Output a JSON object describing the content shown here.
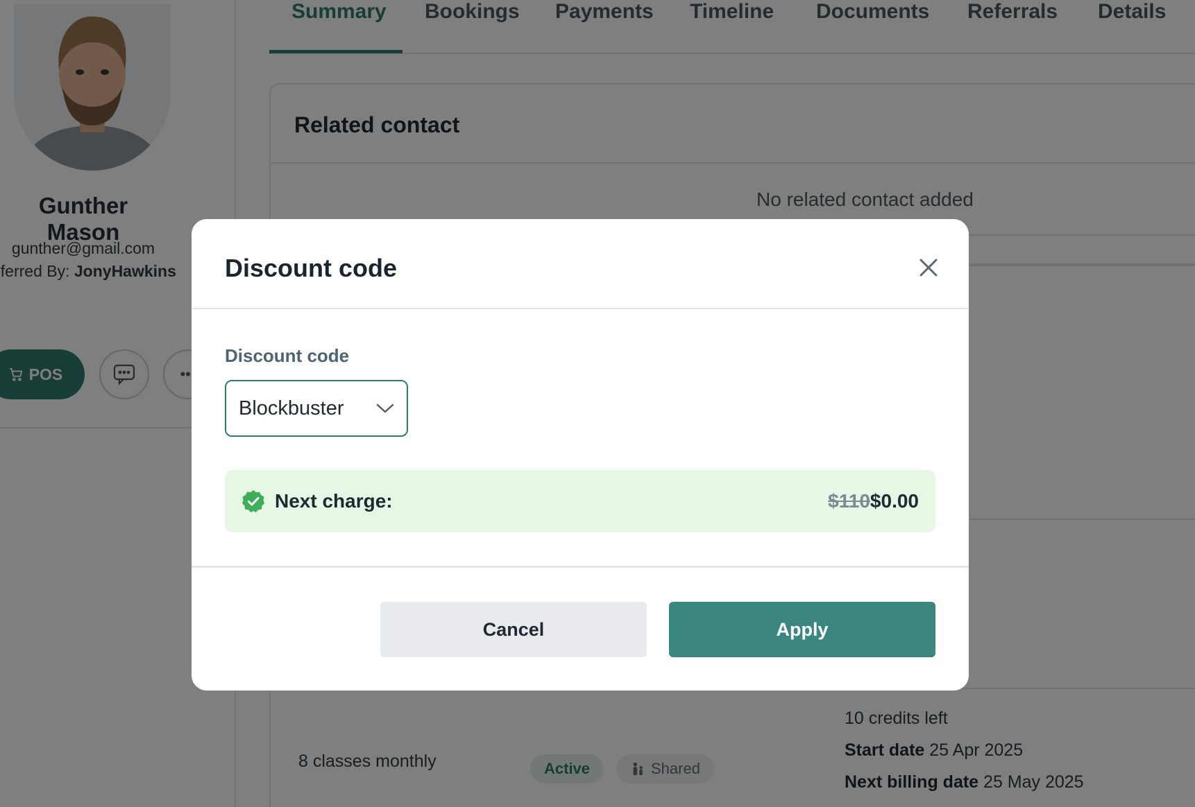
{
  "profile": {
    "name": "Gunther Mason",
    "email": "gunther@gmail.com",
    "referred_prefix": "eferred By: ",
    "referred_name": "JonyHawkins",
    "pos_label": "POS"
  },
  "tabs": [
    "Summary",
    "Bookings",
    "Payments",
    "Timeline",
    "Documents",
    "Referrals",
    "Details"
  ],
  "related_contact": {
    "title": "Related contact",
    "empty": "No related contact added"
  },
  "membership": {
    "name": "8 classes monthly",
    "status": "Active",
    "shared": "Shared",
    "credits": "10 credits left",
    "start_label": "Start date",
    "start_value": "25 Apr 2025",
    "billing_label": "Next billing date",
    "billing_value": "25 May 2025"
  },
  "modal": {
    "title": "Discount code",
    "field_label": "Discount code",
    "selected_code": "Blockbuster",
    "notice_label": "Next charge:",
    "old_price": "$110",
    "new_price": "$0.00",
    "cancel_label": "Cancel",
    "apply_label": "Apply"
  },
  "colors": {
    "accent": "#2f7a6e",
    "apply_button": "#3b8780",
    "success_bg": "#e8f6e6",
    "success_icon": "#3fae5a"
  }
}
